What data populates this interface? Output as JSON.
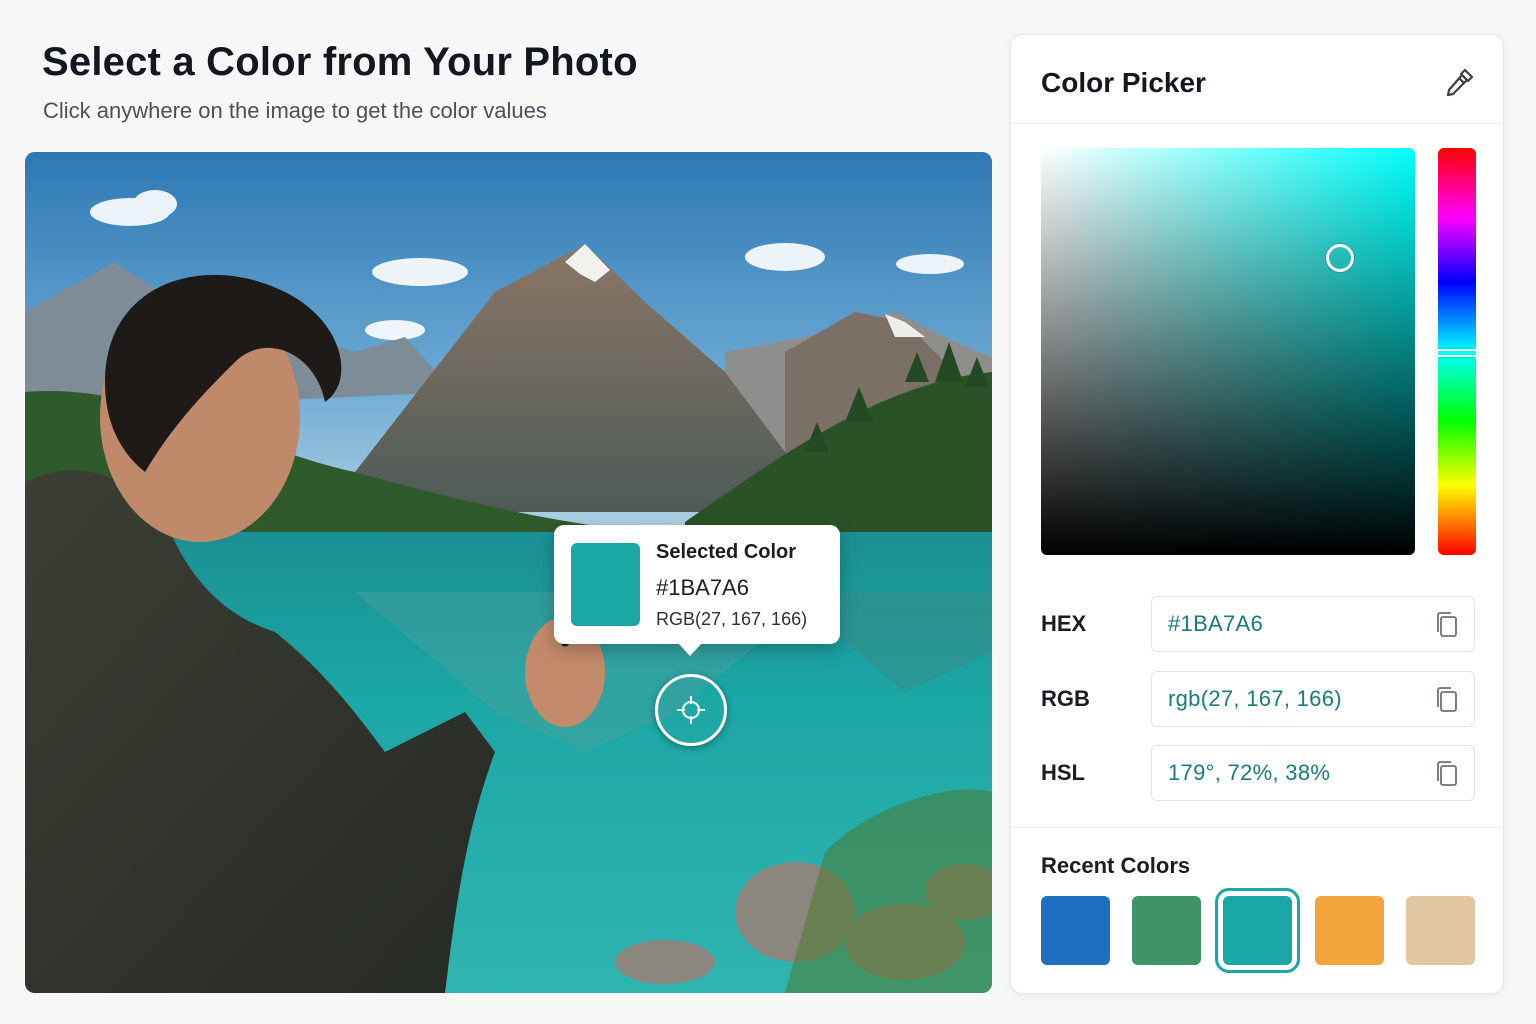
{
  "header": {
    "title": "Select a Color from Your Photo",
    "subtitle": "Click anywhere on the image to get the color values"
  },
  "tooltip": {
    "label": "Selected Color",
    "hex": "#1BA7A6",
    "rgb": "RGB(27, 167, 166)",
    "color": "#1BA7A6"
  },
  "panel": {
    "title": "Color Picker",
    "hue_deg": 179,
    "saturation_fraction": 0.8,
    "value_fraction": 0.73,
    "fields": [
      {
        "label": "HEX",
        "value": "#1BA7A6"
      },
      {
        "label": "RGB",
        "value": "rgb(27, 167, 166)"
      },
      {
        "label": "HSL",
        "value": "179°, 72%, 38%"
      }
    ],
    "recent_title": "Recent Colors",
    "recent": [
      {
        "color": "#1E6FBF",
        "selected": false
      },
      {
        "color": "#3E9465",
        "selected": false
      },
      {
        "color": "#1BA7A6",
        "selected": true
      },
      {
        "color": "#F3A43B",
        "selected": false
      },
      {
        "color": "#E2C6A1",
        "selected": false
      }
    ]
  },
  "icons": {
    "panel": "eyedropper-icon",
    "fields": "copy-icon",
    "photo_cursor": "crosshair-icon"
  }
}
